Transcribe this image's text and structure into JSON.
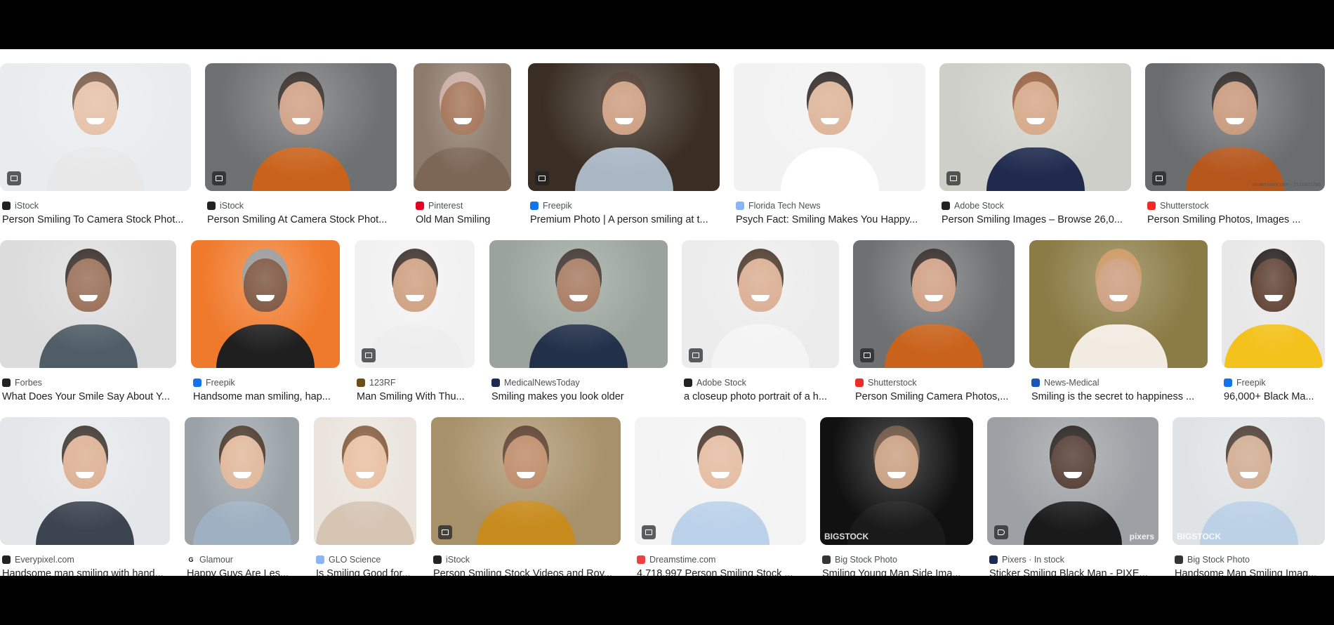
{
  "row1": [
    {
      "source": "iStock",
      "title": "Person Smiling To Camera Stock Phot...",
      "icon": "image-icon",
      "fav": "#222222",
      "bg": "#e9ecef",
      "skin": "#e2b79a",
      "shirt": "#e8e8e8",
      "hair": "#6b4a35"
    },
    {
      "source": "iStock",
      "title": "Person Smiling At Camera Stock Phot...",
      "icon": "image-icon",
      "fav": "#222222",
      "bg": "#6f7072",
      "skin": "#c99272",
      "shirt": "#c9631c",
      "hair": "#1d1510"
    },
    {
      "source": "Pinterest",
      "title": "Old Man Smiling",
      "icon": "",
      "fav": "#e60023",
      "bg": "#8c7a6a",
      "skin": "#9a6546",
      "shirt": "#7c6656",
      "hair": "#c4a59a"
    },
    {
      "source": "Freepik",
      "title": "Premium Photo | A person smiling at t...",
      "icon": "image-icon",
      "fav": "#1273eb",
      "bg": "#3a2e24",
      "skin": "#c5906d",
      "shirt": "#a9b6c4",
      "hair": "#3a2418"
    },
    {
      "source": "Florida Tech News",
      "title": "Psych Fact: Smiling Makes You Happy...",
      "icon": "",
      "fav": "#8ab4f8",
      "bg": "#f2f2f2",
      "skin": "#d7a988",
      "shirt": "#ffffff",
      "hair": "#1a1310"
    },
    {
      "source": "Adobe Stock",
      "title": "Person Smiling Images – Browse 26,0...",
      "icon": "image-icon",
      "fav": "#222222",
      "bg": "#cfcfc9",
      "skin": "#cf9a76",
      "shirt": "#1f2a4d",
      "hair": "#8a4e2a"
    },
    {
      "source": "Shutterstock",
      "title": "Person Smiling Photos, Images ...",
      "icon": "image-icon",
      "fav": "#ee2b24",
      "bg": "#6b6c6e",
      "skin": "#c08a68",
      "shirt": "#b5561c",
      "hair": "#17120f",
      "watermark": "shutterstock.com · 2121831296"
    }
  ],
  "row2": [
    {
      "source": "Forbes",
      "title": "What Does Your Smile Say About Y...",
      "icon": "",
      "fav": "#222222",
      "bg": "#dcdcdc",
      "skin": "#8a5a3e",
      "shirt": "#4f5d66",
      "hair": "#241812"
    },
    {
      "source": "Freepik",
      "title": "Handsome man smiling, hap...",
      "icon": "",
      "fav": "#1273eb",
      "bg": "#f07a2c",
      "skin": "#6b3e26",
      "shirt": "#1f1f1f",
      "hair": "#8f8f8f"
    },
    {
      "source": "123RF",
      "title": "Man Smiling With Thu...",
      "icon": "image-icon",
      "fav": "#6b4e16",
      "bg": "#f1f1f1",
      "skin": "#c8936f",
      "shirt": "#eeeeee",
      "hair": "#2a1d16"
    },
    {
      "source": "MedicalNewsToday",
      "title": "Smiling makes you look older",
      "icon": "",
      "fav": "#1b2a55",
      "bg": "#9aa39c",
      "skin": "#9a6749",
      "shirt": "#22304a",
      "hair": "#2b201a"
    },
    {
      "source": "Adobe Stock",
      "title": "a closeup photo portrait of a h...",
      "icon": "image-icon",
      "fav": "#222222",
      "bg": "#ececec",
      "skin": "#d5a283",
      "shirt": "#f4f4f4",
      "hair": "#3c2618"
    },
    {
      "source": "Shutterstock",
      "title": "Person Smiling Camera Photos,...",
      "icon": "image-icon",
      "fav": "#ee2b24",
      "bg": "#6f7072",
      "skin": "#c99272",
      "shirt": "#c9631c",
      "hair": "#1d1510"
    },
    {
      "source": "News-Medical",
      "title": "Smiling is the secret to happiness ...",
      "icon": "",
      "fav": "#1a56b8",
      "bg": "#8b7b45",
      "skin": "#c58f6b",
      "shirt": "#f1ebe1",
      "hair": "#c58a4e"
    },
    {
      "source": "Freepik",
      "title": "96,000+ Black Ma...",
      "icon": "",
      "fav": "#1273eb",
      "bg": "#e7e7e7",
      "skin": "#4b2a1a",
      "shirt": "#f3c21c",
      "hair": "#120c09"
    }
  ],
  "row3": [
    {
      "source": "Everypixel.com",
      "title": "Handsome man smiling with hand...",
      "icon": "",
      "fav": "#222222",
      "bg": "#e4e7ea",
      "skin": "#d7a583",
      "shirt": "#3c4450",
      "hair": "#2b211b"
    },
    {
      "source": "Glamour",
      "title": "Happy Guys Are Les...",
      "icon": "",
      "fav": "#ffffff",
      "favText": "G",
      "bg": "#9aa2a8",
      "skin": "#dcae8e",
      "shirt": "#9eb0c1",
      "hair": "#3a2818"
    },
    {
      "source": "GLO Science",
      "title": "Is Smiling Good for...",
      "icon": "",
      "fav": "#8ab4f8",
      "bg": "#eae4dd",
      "skin": "#e6b896",
      "shirt": "#d6c5b3",
      "hair": "#7a4f2e"
    },
    {
      "source": "iStock",
      "title": "Person Smiling Stock Videos and Roy...",
      "icon": "image-icon",
      "fav": "#222222",
      "bg": "#a7916a",
      "skin": "#b47a52",
      "shirt": "#c78a1c",
      "hair": "#4a2a16"
    },
    {
      "source": "Dreamstime.com",
      "title": "4,718,997 Person Smiling Stock ...",
      "icon": "image-icon",
      "fav": "#ee4040",
      "bg": "#f3f3f3",
      "skin": "#e0b293",
      "shirt": "#bcd2ea",
      "hair": "#3a2418"
    },
    {
      "source": "Big Stock Photo",
      "title": "Smiling Young Man Side Ima...",
      "icon": "",
      "fav": "#333333",
      "bg": "#111111",
      "skin": "#c2926f",
      "shirt": "#1a1a1a",
      "hair": "#5b3f2b",
      "watermark": "BIGSTOCK"
    },
    {
      "source": "Pixers · In stock",
      "title": "Sticker Smiling Black Man - PIXE...",
      "icon": "tag-icon",
      "fav": "#1b2a55",
      "bg": "#9da0a4",
      "skin": "#3c2217",
      "shirt": "#1a1a1a",
      "hair": "#110b08",
      "watermark": "pixers"
    },
    {
      "source": "Big Stock Photo",
      "title": "Handsome Man Smiling Imag...",
      "icon": "",
      "fav": "#333333",
      "bg": "#dfe3e6",
      "skin": "#caa081",
      "shirt": "#bcd1e6",
      "hair": "#3b2a1e",
      "watermark": "BIGSTOCK"
    }
  ]
}
